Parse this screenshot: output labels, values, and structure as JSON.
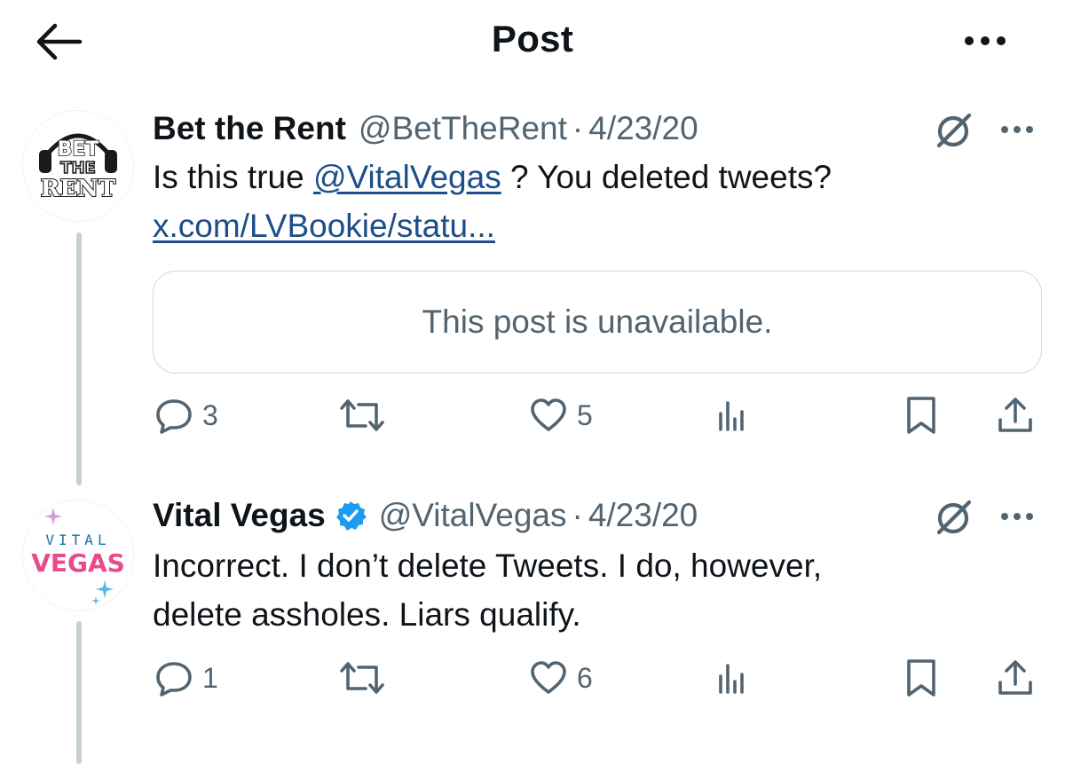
{
  "header": {
    "title": "Post",
    "back_icon": "arrow-left-icon",
    "more_icon": "more-horizontal-icon"
  },
  "tweets": [
    {
      "name": "Bet the Rent",
      "handle": "@BetTheRent",
      "separator": "·",
      "date": "4/23/20",
      "verified": false,
      "avatar_text": [
        "BET",
        "THE",
        "RENT"
      ],
      "text_before_mention": "Is this true ",
      "mention": "@VitalVegas",
      "text_after_mention": " ? You deleted tweets?",
      "link": "x.com/LVBookie/statu...",
      "quote_unavailable": "This post is unavailable.",
      "replies": "3",
      "retweets": "",
      "likes": "5"
    },
    {
      "name": "Vital Vegas",
      "handle": "@VitalVegas",
      "separator": "·",
      "date": "4/23/20",
      "verified": true,
      "avatar_text": [
        "VITAL",
        "VEGAS"
      ],
      "text_line1": "Incorrect. I don’t delete Tweets. I do, however,",
      "text_line2": "delete assholes. Liars qualify.",
      "replies": "1",
      "retweets": "",
      "likes": "6"
    }
  ],
  "colors": {
    "text_primary": "#0f1419",
    "text_secondary": "#536471",
    "link": "#1d4e89",
    "verified": "#1d9bf0",
    "border": "#cfd9de",
    "vegas_pink": "#e94b8a"
  }
}
